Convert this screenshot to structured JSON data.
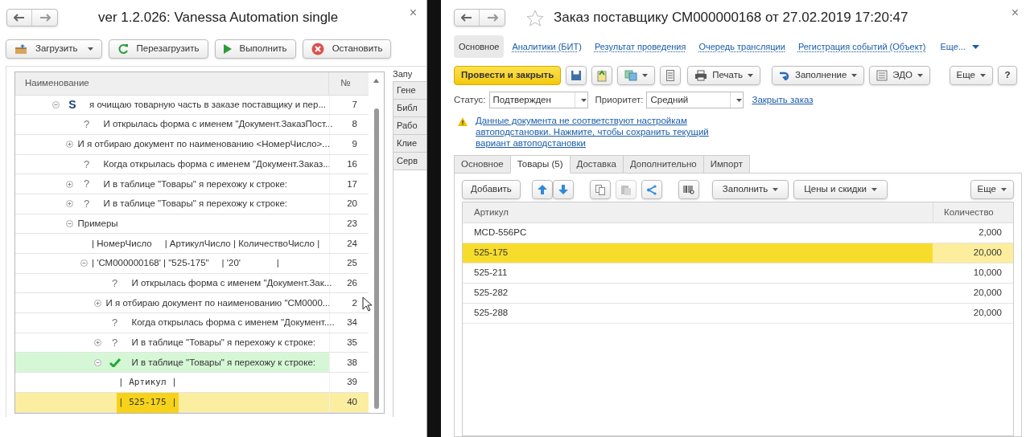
{
  "left_window": {
    "title": "ver 1.2.026: Vanessa Automation single",
    "close": "×",
    "toolbar": [
      {
        "label": "Загрузить",
        "kind": "load",
        "dropdown": true
      },
      {
        "label": "Перезагрузить",
        "kind": "reload",
        "dropdown": false
      },
      {
        "label": "Выполнить",
        "kind": "run",
        "dropdown": false
      },
      {
        "label": "Остановить",
        "kind": "stop",
        "dropdown": false
      }
    ],
    "tree": {
      "columns": [
        "Наименование",
        "№"
      ],
      "rows": [
        {
          "marker": "S",
          "text": "я очищаю товарную часть в заказе поставщику и пер...",
          "number": "7",
          "expanded": true,
          "passed": false,
          "selected": false,
          "kind": "step",
          "children": [
            {
              "marker": "?",
              "text": "И открылась форма с именем \"Документ.ЗаказПост...",
              "number": "8",
              "passed": false,
              "selected": false,
              "kind": "step"
            },
            {
              "text": "И я отбираю документ по наименованию <НомерЧисло>...",
              "number": "9",
              "expanded": false,
              "passed": false,
              "selected": false,
              "kind": "step"
            },
            {
              "marker": "?",
              "text": "Когда открылась форма с именем \"Документ.Заказ...",
              "number": "16",
              "passed": false,
              "selected": false,
              "kind": "step"
            },
            {
              "marker": "?",
              "text": "И в таблице \"Товары\" я перехожу к строке:",
              "number": "17",
              "expanded": false,
              "passed": false,
              "selected": false,
              "kind": "step"
            },
            {
              "marker": "?",
              "text": "И в таблице \"Товары\" я перехожу к строке:",
              "number": "20",
              "expanded": false,
              "passed": false,
              "selected": false,
              "kind": "step"
            },
            {
              "text": "Примеры",
              "number": "23",
              "expanded": true,
              "passed": false,
              "selected": false,
              "kind": "step",
              "children": [
                {
                  "text": "| НомерЧисло     | АртикулЧисло | КоличествоЧисло |",
                  "number": "24",
                  "passed": false,
                  "selected": false,
                  "kind": "step"
                },
                {
                  "text": "| 'СМ000000168' | \"525-175\"     | '20'              |",
                  "number": "25",
                  "expanded": true,
                  "passed": false,
                  "selected": false,
                  "kind": "step",
                  "children": [
                    {
                      "marker": "?",
                      "text": "И открылась форма с именем \"Документ.Зак...",
                      "number": "26",
                      "passed": false,
                      "selected": false,
                      "kind": "step"
                    },
                    {
                      "text": "И я отбираю документ по наименованию \"СМ0000...",
                      "number": "2",
                      "expanded": false,
                      "passed": false,
                      "selected": false,
                      "kind": "step"
                    },
                    {
                      "marker": "?",
                      "text": "Когда открылась форма с именем \"Документ....",
                      "number": "34",
                      "passed": false,
                      "selected": false,
                      "kind": "step"
                    },
                    {
                      "marker": "?",
                      "text": "И в таблице \"Товары\" я перехожу к строке:",
                      "number": "35",
                      "expanded": false,
                      "passed": false,
                      "selected": false,
                      "kind": "step"
                    },
                    {
                      "text": "И в таблице \"Товары\" я перехожу к строке:",
                      "number": "38",
                      "expanded": true,
                      "passed": true,
                      "selected": false,
                      "kind": "step",
                      "children": [
                        {
                          "text": "| Артикул |",
                          "number": "39",
                          "passed": false,
                          "selected": false,
                          "kind": "table_row"
                        },
                        {
                          "text": "| 525-175 |",
                          "number": "40",
                          "passed": false,
                          "selected": true,
                          "kind": "table_row"
                        }
                      ]
                    }
                  ]
                }
              ]
            }
          ]
        }
      ]
    },
    "side_caption": "Запу",
    "side_tabs": [
      "Гене",
      "Библ",
      "Рабо",
      "Клие",
      "Серв"
    ]
  },
  "right_window": {
    "title": "Заказ поставщику СМ000000168 от 27.02.2019 17:20:47",
    "close": "×",
    "nav": [
      {
        "label": "Основное",
        "selected": true
      },
      {
        "label": "Аналитики (БИТ)",
        "selected": false
      },
      {
        "label": "Результат проведения",
        "selected": false
      },
      {
        "label": "Очередь трансляции",
        "selected": false
      },
      {
        "label": "Регистрация событий (Объект)",
        "selected": false
      }
    ],
    "nav_more": "Еще...",
    "commands": {
      "primary": "Провести и закрыть",
      "print": "Печать",
      "fill": "Заполнение",
      "edo": "ЭДО",
      "more": "Еще",
      "help": "?"
    },
    "status": {
      "label": "Статус:",
      "value": "Подтвержден"
    },
    "priority": {
      "label": "Приоритет:",
      "value": "Средний"
    },
    "close_order": "Закрыть заказ",
    "warning": "Данные документа не соответствуют настройкам автоподстановки. Нажмите, чтобы сохранить текущий вариант автоподстановки",
    "tabs": [
      {
        "label": "Основное",
        "selected": false
      },
      {
        "label": "Товары (5)",
        "selected": true
      },
      {
        "label": "Доставка",
        "selected": false
      },
      {
        "label": "Дополнительно",
        "selected": false
      },
      {
        "label": "Импорт",
        "selected": false
      }
    ],
    "table_toolbar": {
      "add": "Добавить",
      "fill": "Заполнить",
      "prices": "Цены и скидки",
      "more": "Еще"
    },
    "table": {
      "columns": [
        "Артикул",
        "Количество"
      ],
      "rows": [
        {
          "article": "MCD-556PC",
          "quantity": "2,000",
          "selected": false
        },
        {
          "article": "525-175",
          "quantity": "20,000",
          "selected": true
        },
        {
          "article": "525-211",
          "quantity": "10,000",
          "selected": false
        },
        {
          "article": "525-282",
          "quantity": "20,000",
          "selected": false
        },
        {
          "article": "525-288",
          "quantity": "20,000",
          "selected": false
        }
      ]
    }
  }
}
